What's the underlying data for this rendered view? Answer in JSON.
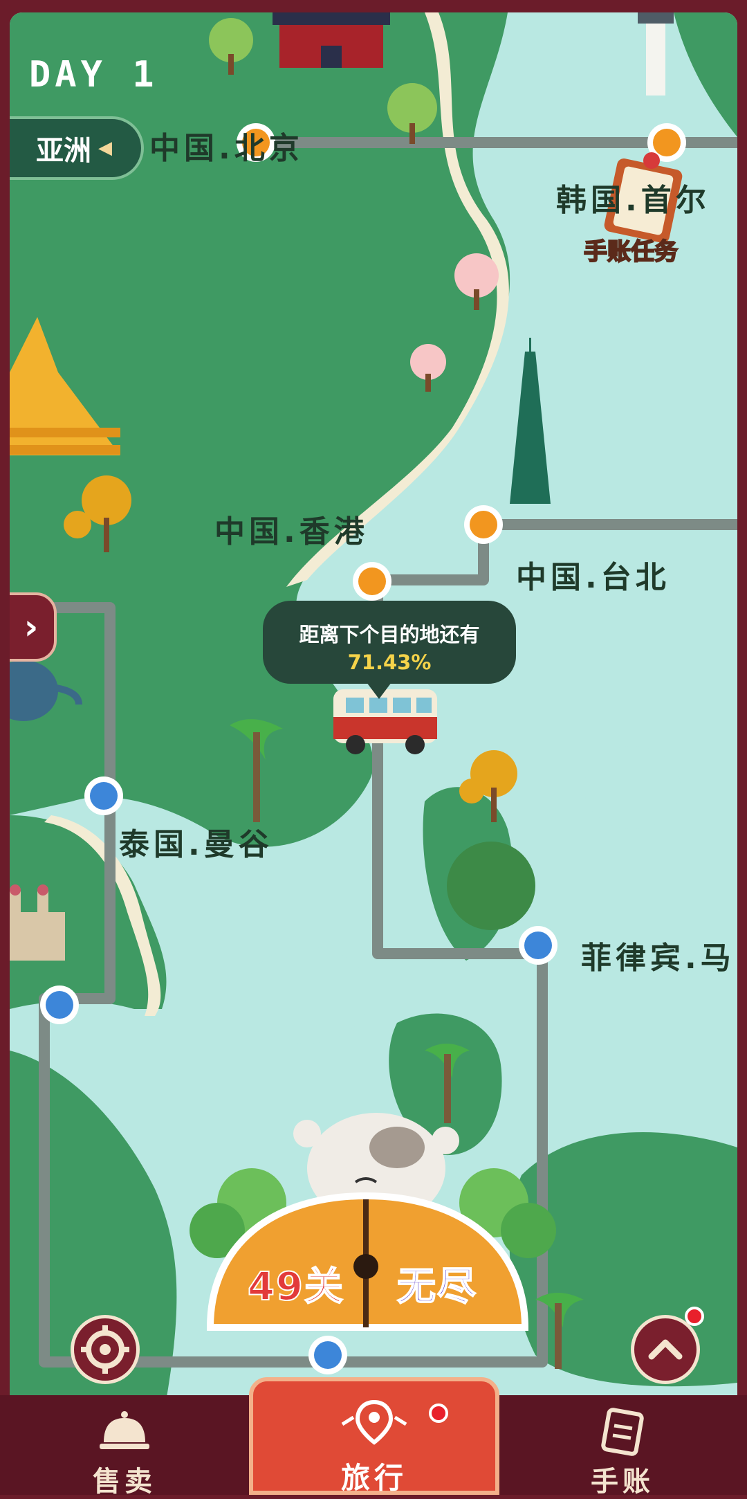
{
  "hud": {
    "day": "DAY 1",
    "region": "亚洲"
  },
  "cities": {
    "beijing": "中国.北京",
    "seoul": "韩国.首尔",
    "hongkong": "中国.香港",
    "taipei": "中国.台北",
    "bangkok": "泰国.曼谷",
    "philippines": "菲律宾.马"
  },
  "tooltip": {
    "line1": "距离下个目的地还有",
    "progress": "71.43%"
  },
  "task": {
    "label": "手账任务"
  },
  "levels": {
    "left": "49关",
    "right": "无尽"
  },
  "nav": {
    "sell": "售卖",
    "travel": "旅行",
    "journal": "手账"
  },
  "colors": {
    "accent_red": "#e04a36",
    "frame": "#6b1c2a",
    "land": "#3f9a63",
    "sea": "#b9e8e2"
  }
}
